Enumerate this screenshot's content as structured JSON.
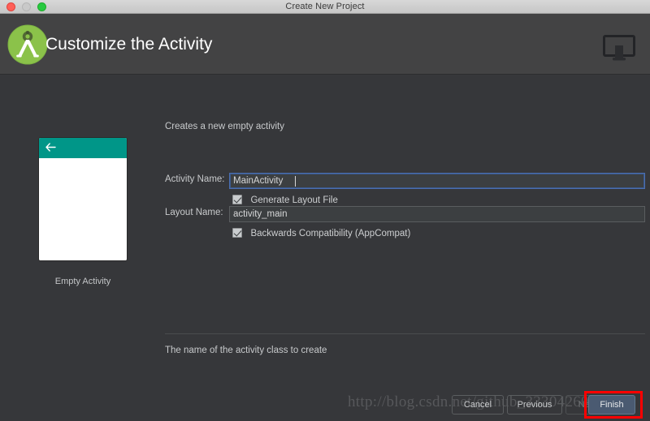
{
  "window": {
    "title": "Create New Project",
    "traffic_lights": [
      "close-button",
      "minimize-button",
      "maximize-button"
    ]
  },
  "header": {
    "title": "Customize the Activity",
    "logo_icon": "android-studio-logo-icon",
    "right_icon": "monitor-display-icon",
    "accent_green": "#8bc24a",
    "bg": "#434344"
  },
  "template_preview": {
    "label": "Empty Activity",
    "appbar_color": "#009688",
    "back_icon": "back-arrow-icon"
  },
  "form": {
    "description": "Creates a new empty activity",
    "activity_name": {
      "label": "Activity Name:",
      "value": "MainActivity",
      "focused": true
    },
    "generate_layout": {
      "label": "Generate Layout File",
      "checked": true
    },
    "layout_name": {
      "label": "Layout Name:",
      "value": "activity_main",
      "focused": false
    },
    "backwards_compatibility": {
      "label": "Backwards Compatibility (AppCompat)",
      "checked": true
    },
    "hint": "The name of the activity class to create"
  },
  "buttons": {
    "cancel": "Cancel",
    "previous": "Previous",
    "next": "Next",
    "finish": "Finish"
  },
  "annotation": {
    "highlight_color": "#ff0000",
    "target": "finish-button"
  },
  "watermark": {
    "text": "http://blog.csdn.net/github_33304260"
  }
}
